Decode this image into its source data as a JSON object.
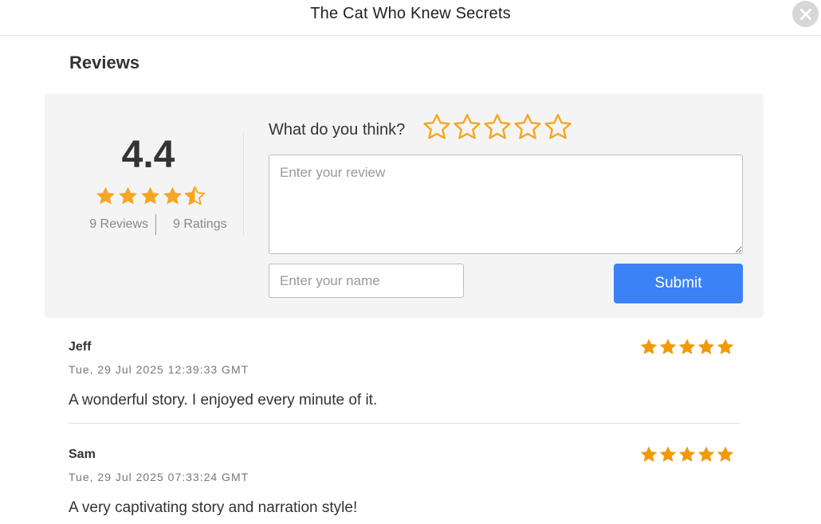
{
  "header": {
    "title": "The Cat Who Knew Secrets",
    "close_icon": "close-icon"
  },
  "reviews_section": {
    "title": "Reviews"
  },
  "summary": {
    "average": "4.4",
    "average_stars": 4.4,
    "reviews_count": "9 Reviews",
    "ratings_count": "9 Ratings"
  },
  "form": {
    "prompt": "What do you think?",
    "rating_max": 5,
    "review_placeholder": "Enter your review",
    "name_placeholder": "Enter your name",
    "submit_label": "Submit"
  },
  "reviews": [
    {
      "author": "Jeff",
      "date": "Tue, 29 Jul 2025 12:39:33 GMT",
      "text": "A wonderful story. I enjoyed every minute of it.",
      "rating": 5
    },
    {
      "author": "Sam",
      "date": "Tue, 29 Jul 2025 07:33:24 GMT",
      "text": "A very captivating story and narration style!",
      "rating": 5
    }
  ],
  "colors": {
    "star_summary": "#f5a623",
    "star_review": "#f09a0a",
    "star_outline": "#f5a623",
    "accent": "#3b82f6",
    "panel_bg": "#f4f4f4"
  }
}
